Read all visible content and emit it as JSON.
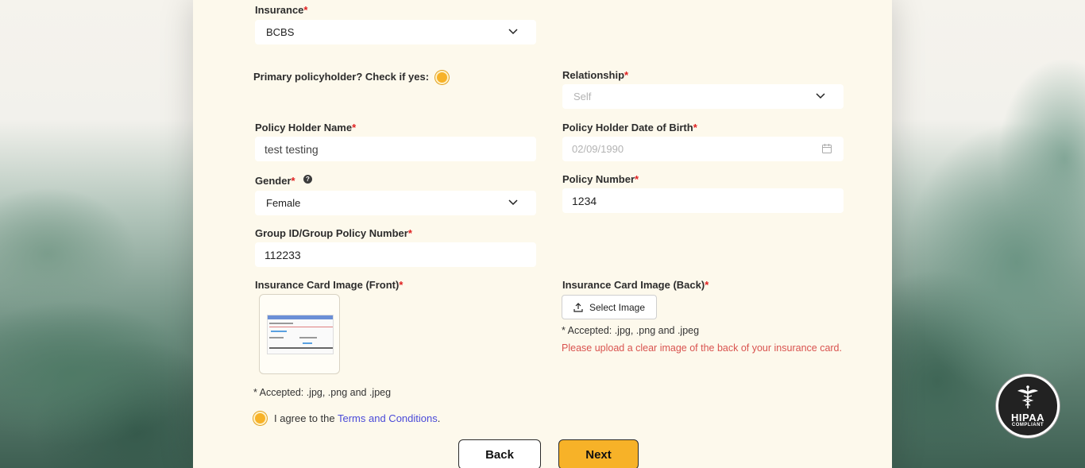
{
  "form": {
    "insurance": {
      "label": "Insurance",
      "value": "BCBS"
    },
    "primary_policyholder": {
      "label": "Primary policyholder? Check if yes:"
    },
    "relationship": {
      "label": "Relationship",
      "value": "Self"
    },
    "policy_holder_name": {
      "label": "Policy Holder Name",
      "value": "test testing"
    },
    "policy_holder_dob": {
      "label": "Policy Holder Date of Birth",
      "value": "02/09/1990"
    },
    "gender": {
      "label": "Gender",
      "value": "Female",
      "help": "?"
    },
    "policy_number": {
      "label": "Policy Number",
      "value": "1234"
    },
    "group_id": {
      "label": "Group ID/Group Policy Number",
      "value": "112233"
    },
    "card_front": {
      "label": "Insurance Card Image (Front)",
      "accepted": "* Accepted: .jpg, .png and .jpeg"
    },
    "card_back": {
      "label": "Insurance Card Image (Back)",
      "button": "Select Image",
      "accepted": "* Accepted: .jpg, .png and .jpeg",
      "error": "Please upload a clear image of the back of your insurance card."
    },
    "agree": {
      "prefix": "I agree to the ",
      "link": "Terms and Conditions",
      "suffix": "."
    },
    "required_mark": "*"
  },
  "actions": {
    "back": "Back",
    "next": "Next"
  },
  "badge": {
    "title": "HIPAA",
    "subtitle": "COMPLIANT"
  },
  "colors": {
    "accent": "#f7b228",
    "error": "#d9534f",
    "link": "#4a4ad8",
    "card_bg": "#fdf9ec"
  }
}
